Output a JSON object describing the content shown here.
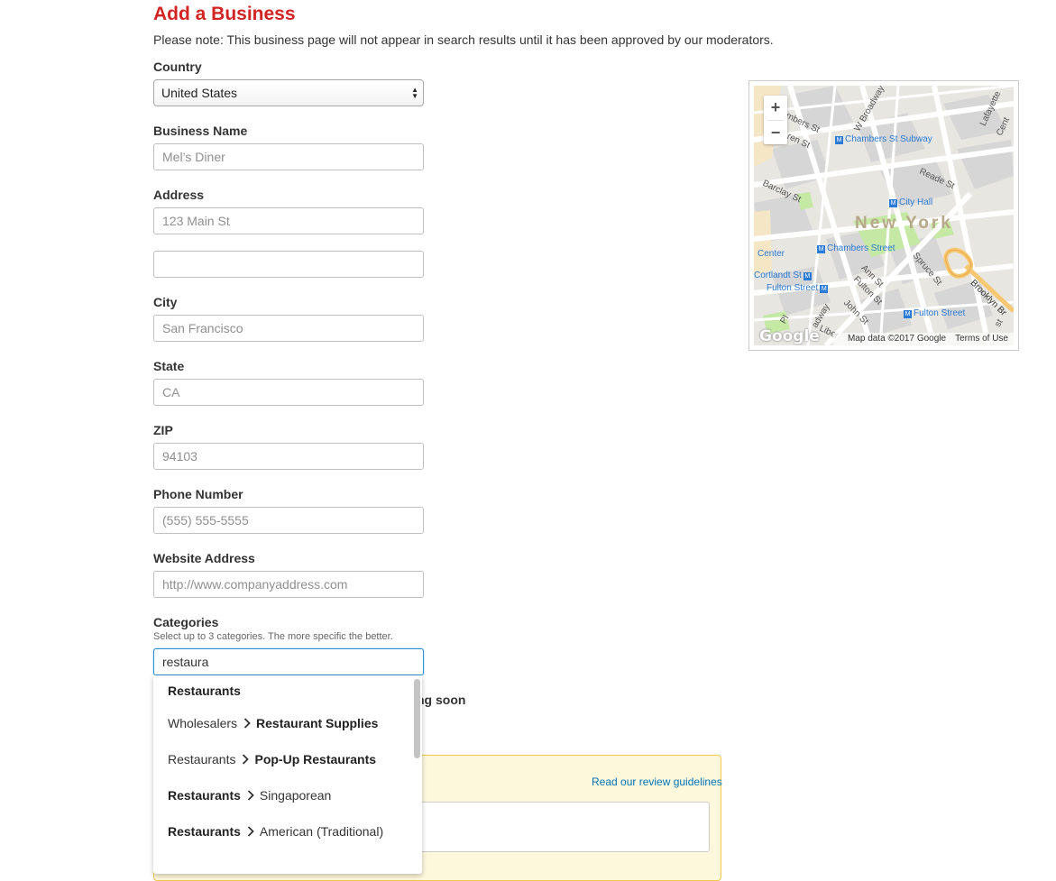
{
  "header": {
    "title": "Add a Business",
    "note": "Please note: This business page will not appear in search results until it has been approved by our moderators."
  },
  "form": {
    "country": {
      "label": "Country",
      "value": "United States"
    },
    "business_name": {
      "label": "Business Name",
      "placeholder": "Mel’s Diner"
    },
    "address": {
      "label": "Address",
      "placeholder": "123 Main St",
      "placeholder2": ""
    },
    "city": {
      "label": "City",
      "placeholder": "San Francisco"
    },
    "state": {
      "label": "State",
      "placeholder": "CA"
    },
    "zip": {
      "label": "ZIP",
      "placeholder": "94103"
    },
    "phone": {
      "label": "Phone Number",
      "placeholder": "(555) 555-5555"
    },
    "website": {
      "label": "Website Address",
      "placeholder": "http://www.companyaddress.com"
    },
    "categories": {
      "label": "Categories",
      "helper": "Select up to 3 categories. The more specific the better.",
      "value": "restaura"
    }
  },
  "autocomplete": {
    "items": [
      {
        "parent": "",
        "child": "Restaurants",
        "parent_bold": false,
        "child_bold": true
      },
      {
        "parent": "Wholesalers",
        "child": "Restaurant Supplies",
        "parent_bold": false,
        "child_bold": true
      },
      {
        "parent": "Restaurants",
        "child": "Pop-Up Restaurants",
        "parent_bold": false,
        "child_bold": true
      },
      {
        "parent": "Restaurants",
        "child": "Singaporean",
        "parent_bold": true,
        "child_bold": false
      },
      {
        "parent": "Restaurants",
        "child": "American (Traditional)",
        "parent_bold": true,
        "child_bold": false
      }
    ]
  },
  "partial_text": {
    "coming_soon": "ng soon"
  },
  "review": {
    "guidelines_link": "Read our review guidelines"
  },
  "map": {
    "zoom_in": "+",
    "zoom_out": "−",
    "city_label": "New York",
    "labels": {
      "chambers_st_subway": "Chambers St Subway",
      "city_hall": "City Hall",
      "chambers_street": "Chambers Street",
      "fulton_street": "Fulton Street",
      "fulton_street_2": "Fulton Street",
      "cortlandt_st": "Cortlandt St",
      "center": "Center",
      "reade_st": "Reade St",
      "barclay_st": "Barclay St",
      "ann_st": "Ann St",
      "fulton_st": "Fulton St",
      "spruce_st": "Spruce St",
      "john_st": "John St",
      "w_broadway": "W Broadway",
      "lafayette": "Lafayette",
      "brooklyn_br": "Brooklyn Br",
      "chambers_st": "mbers St",
      "warren_st": "ren St",
      "broadway": "adway",
      "liberty": "Liber",
      "pl": "Pl",
      "st": "st",
      "cent": "Cent"
    },
    "google": "Google",
    "map_data": "Map data ©2017 Google",
    "terms": "Terms of Use",
    "colors": {
      "land": "#e8e6e1",
      "road": "#ffffff",
      "park": "#c5e8a4",
      "block": "#d4d4d4",
      "highway": "#f7c873",
      "label_blue": "#2a7bd6"
    }
  }
}
